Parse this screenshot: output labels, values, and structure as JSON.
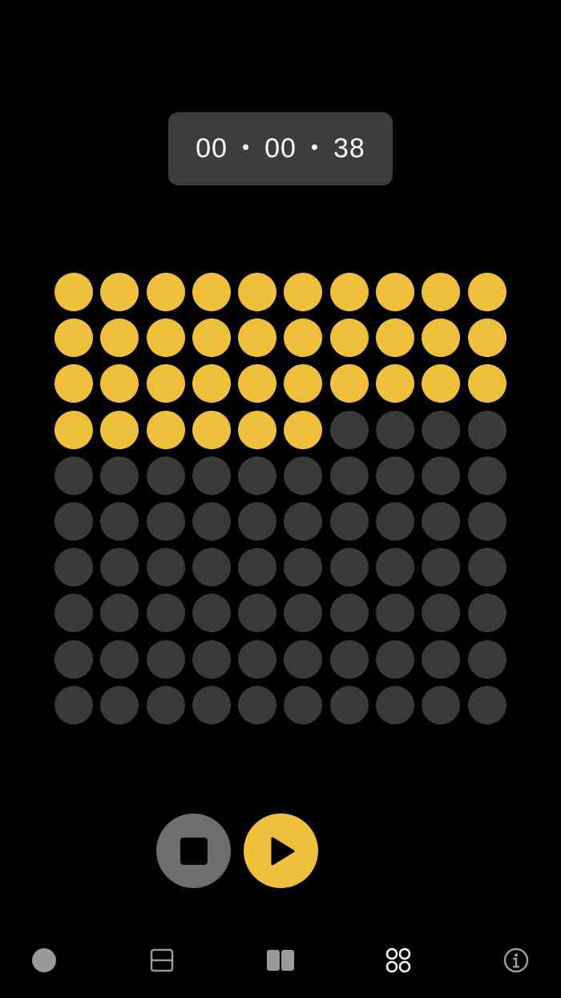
{
  "timer": {
    "hours": "00",
    "minutes": "00",
    "seconds": "38",
    "separator": "•"
  },
  "dot_grid": {
    "rows": 10,
    "columns": 10,
    "filled": 36
  },
  "controls": {
    "stop_icon": "stop-square-icon",
    "play_icon": "play-triangle-icon"
  },
  "tab_bar": {
    "items": [
      {
        "icon": "circle-icon"
      },
      {
        "icon": "split-horizontal-icon"
      },
      {
        "icon": "split-vertical-icon"
      },
      {
        "icon": "grid-four-circles-icon"
      },
      {
        "icon": "info-icon"
      }
    ]
  },
  "colors": {
    "accent": "#f0bf3c",
    "dot_off": "#3a3a3a",
    "timer_bg": "#3d3d3d",
    "stop_bg": "#6e6e6e",
    "tab_icon": "#9a9a9a"
  }
}
